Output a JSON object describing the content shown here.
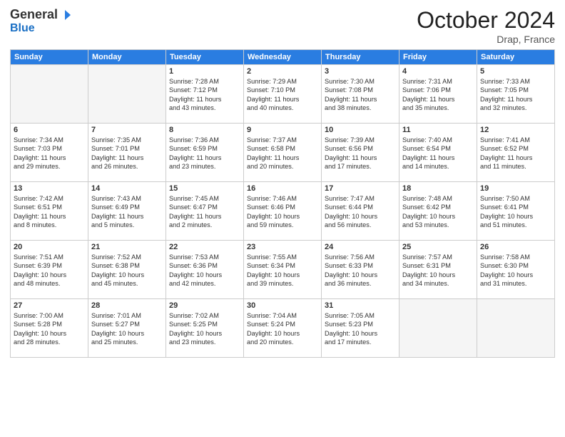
{
  "header": {
    "logo": {
      "general": "General",
      "blue": "Blue"
    },
    "title": "October 2024",
    "location": "Drap, France"
  },
  "days_of_week": [
    "Sunday",
    "Monday",
    "Tuesday",
    "Wednesday",
    "Thursday",
    "Friday",
    "Saturday"
  ],
  "weeks": [
    [
      {
        "day": "",
        "empty": true
      },
      {
        "day": "",
        "empty": true
      },
      {
        "day": "1",
        "lines": [
          "Sunrise: 7:28 AM",
          "Sunset: 7:12 PM",
          "Daylight: 11 hours",
          "and 43 minutes."
        ]
      },
      {
        "day": "2",
        "lines": [
          "Sunrise: 7:29 AM",
          "Sunset: 7:10 PM",
          "Daylight: 11 hours",
          "and 40 minutes."
        ]
      },
      {
        "day": "3",
        "lines": [
          "Sunrise: 7:30 AM",
          "Sunset: 7:08 PM",
          "Daylight: 11 hours",
          "and 38 minutes."
        ]
      },
      {
        "day": "4",
        "lines": [
          "Sunrise: 7:31 AM",
          "Sunset: 7:06 PM",
          "Daylight: 11 hours",
          "and 35 minutes."
        ]
      },
      {
        "day": "5",
        "lines": [
          "Sunrise: 7:33 AM",
          "Sunset: 7:05 PM",
          "Daylight: 11 hours",
          "and 32 minutes."
        ]
      }
    ],
    [
      {
        "day": "6",
        "lines": [
          "Sunrise: 7:34 AM",
          "Sunset: 7:03 PM",
          "Daylight: 11 hours",
          "and 29 minutes."
        ]
      },
      {
        "day": "7",
        "lines": [
          "Sunrise: 7:35 AM",
          "Sunset: 7:01 PM",
          "Daylight: 11 hours",
          "and 26 minutes."
        ]
      },
      {
        "day": "8",
        "lines": [
          "Sunrise: 7:36 AM",
          "Sunset: 6:59 PM",
          "Daylight: 11 hours",
          "and 23 minutes."
        ]
      },
      {
        "day": "9",
        "lines": [
          "Sunrise: 7:37 AM",
          "Sunset: 6:58 PM",
          "Daylight: 11 hours",
          "and 20 minutes."
        ]
      },
      {
        "day": "10",
        "lines": [
          "Sunrise: 7:39 AM",
          "Sunset: 6:56 PM",
          "Daylight: 11 hours",
          "and 17 minutes."
        ]
      },
      {
        "day": "11",
        "lines": [
          "Sunrise: 7:40 AM",
          "Sunset: 6:54 PM",
          "Daylight: 11 hours",
          "and 14 minutes."
        ]
      },
      {
        "day": "12",
        "lines": [
          "Sunrise: 7:41 AM",
          "Sunset: 6:52 PM",
          "Daylight: 11 hours",
          "and 11 minutes."
        ]
      }
    ],
    [
      {
        "day": "13",
        "lines": [
          "Sunrise: 7:42 AM",
          "Sunset: 6:51 PM",
          "Daylight: 11 hours",
          "and 8 minutes."
        ]
      },
      {
        "day": "14",
        "lines": [
          "Sunrise: 7:43 AM",
          "Sunset: 6:49 PM",
          "Daylight: 11 hours",
          "and 5 minutes."
        ]
      },
      {
        "day": "15",
        "lines": [
          "Sunrise: 7:45 AM",
          "Sunset: 6:47 PM",
          "Daylight: 11 hours",
          "and 2 minutes."
        ]
      },
      {
        "day": "16",
        "lines": [
          "Sunrise: 7:46 AM",
          "Sunset: 6:46 PM",
          "Daylight: 10 hours",
          "and 59 minutes."
        ]
      },
      {
        "day": "17",
        "lines": [
          "Sunrise: 7:47 AM",
          "Sunset: 6:44 PM",
          "Daylight: 10 hours",
          "and 56 minutes."
        ]
      },
      {
        "day": "18",
        "lines": [
          "Sunrise: 7:48 AM",
          "Sunset: 6:42 PM",
          "Daylight: 10 hours",
          "and 53 minutes."
        ]
      },
      {
        "day": "19",
        "lines": [
          "Sunrise: 7:50 AM",
          "Sunset: 6:41 PM",
          "Daylight: 10 hours",
          "and 51 minutes."
        ]
      }
    ],
    [
      {
        "day": "20",
        "lines": [
          "Sunrise: 7:51 AM",
          "Sunset: 6:39 PM",
          "Daylight: 10 hours",
          "and 48 minutes."
        ]
      },
      {
        "day": "21",
        "lines": [
          "Sunrise: 7:52 AM",
          "Sunset: 6:38 PM",
          "Daylight: 10 hours",
          "and 45 minutes."
        ]
      },
      {
        "day": "22",
        "lines": [
          "Sunrise: 7:53 AM",
          "Sunset: 6:36 PM",
          "Daylight: 10 hours",
          "and 42 minutes."
        ]
      },
      {
        "day": "23",
        "lines": [
          "Sunrise: 7:55 AM",
          "Sunset: 6:34 PM",
          "Daylight: 10 hours",
          "and 39 minutes."
        ]
      },
      {
        "day": "24",
        "lines": [
          "Sunrise: 7:56 AM",
          "Sunset: 6:33 PM",
          "Daylight: 10 hours",
          "and 36 minutes."
        ]
      },
      {
        "day": "25",
        "lines": [
          "Sunrise: 7:57 AM",
          "Sunset: 6:31 PM",
          "Daylight: 10 hours",
          "and 34 minutes."
        ]
      },
      {
        "day": "26",
        "lines": [
          "Sunrise: 7:58 AM",
          "Sunset: 6:30 PM",
          "Daylight: 10 hours",
          "and 31 minutes."
        ]
      }
    ],
    [
      {
        "day": "27",
        "lines": [
          "Sunrise: 7:00 AM",
          "Sunset: 5:28 PM",
          "Daylight: 10 hours",
          "and 28 minutes."
        ]
      },
      {
        "day": "28",
        "lines": [
          "Sunrise: 7:01 AM",
          "Sunset: 5:27 PM",
          "Daylight: 10 hours",
          "and 25 minutes."
        ]
      },
      {
        "day": "29",
        "lines": [
          "Sunrise: 7:02 AM",
          "Sunset: 5:25 PM",
          "Daylight: 10 hours",
          "and 23 minutes."
        ]
      },
      {
        "day": "30",
        "lines": [
          "Sunrise: 7:04 AM",
          "Sunset: 5:24 PM",
          "Daylight: 10 hours",
          "and 20 minutes."
        ]
      },
      {
        "day": "31",
        "lines": [
          "Sunrise: 7:05 AM",
          "Sunset: 5:23 PM",
          "Daylight: 10 hours",
          "and 17 minutes."
        ]
      },
      {
        "day": "",
        "empty": true
      },
      {
        "day": "",
        "empty": true
      }
    ]
  ]
}
